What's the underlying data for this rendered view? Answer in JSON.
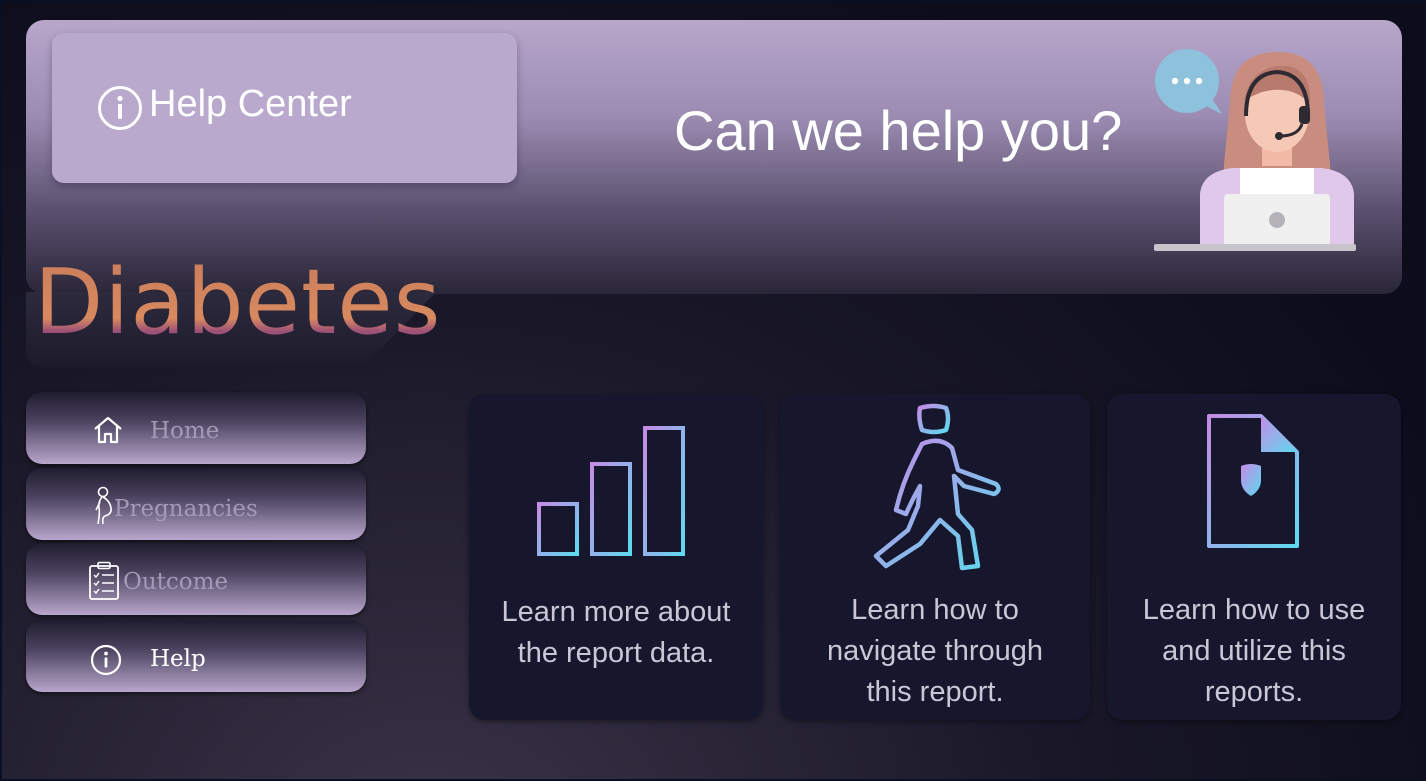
{
  "header": {
    "help_center_title": "Help Center",
    "question": "Can we help you?"
  },
  "brand": {
    "title": "Diabetes"
  },
  "nav": {
    "home": "Home",
    "pregnancies": "Pregnancies",
    "outcome": "Outcome",
    "help": "Help"
  },
  "cards": [
    {
      "text_line1": "Learn more about",
      "text_line2": "the report data.",
      "icon": "bar-chart-icon"
    },
    {
      "text_line1": "Learn how to",
      "text_line2": "navigate through",
      "text_line3": "this report.",
      "icon": "walking-person-icon"
    },
    {
      "text_line1": "Learn how to use",
      "text_line2": "and utilize this",
      "text_line3": "reports.",
      "icon": "secure-document-icon"
    }
  ],
  "colors": {
    "banner_top": "#b8a6cb",
    "card_bg": "#16162c",
    "icon_gradient_start": "#c58be6",
    "icon_gradient_end": "#5ed9ee",
    "brand_text": "#d8895e"
  }
}
